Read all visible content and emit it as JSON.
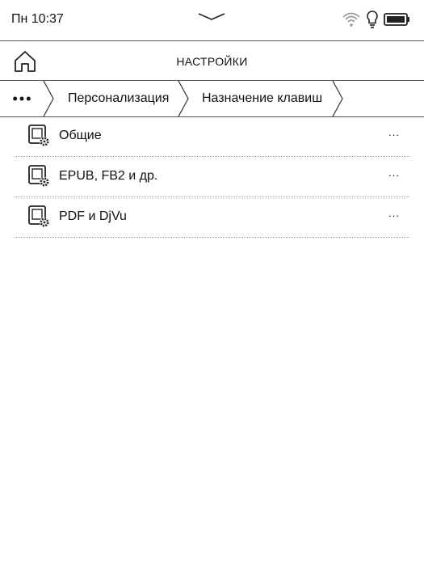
{
  "status": {
    "time": "Пн 10:37",
    "icons": [
      "wifi-icon",
      "light-bulb-icon",
      "battery-icon"
    ]
  },
  "header": {
    "title": "НАСТРОЙКИ",
    "home_icon": "home-icon"
  },
  "breadcrumb": {
    "more": "•••",
    "items": [
      {
        "label": "Персонализация"
      },
      {
        "label": "Назначение клавиш"
      }
    ]
  },
  "list": {
    "items": [
      {
        "label": "Общие",
        "more": "...",
        "icon": "settings-document-icon"
      },
      {
        "label": "EPUB, FB2 и др.",
        "more": "...",
        "icon": "settings-document-icon"
      },
      {
        "label": "PDF и DjVu",
        "more": "...",
        "icon": "settings-document-icon"
      }
    ]
  }
}
